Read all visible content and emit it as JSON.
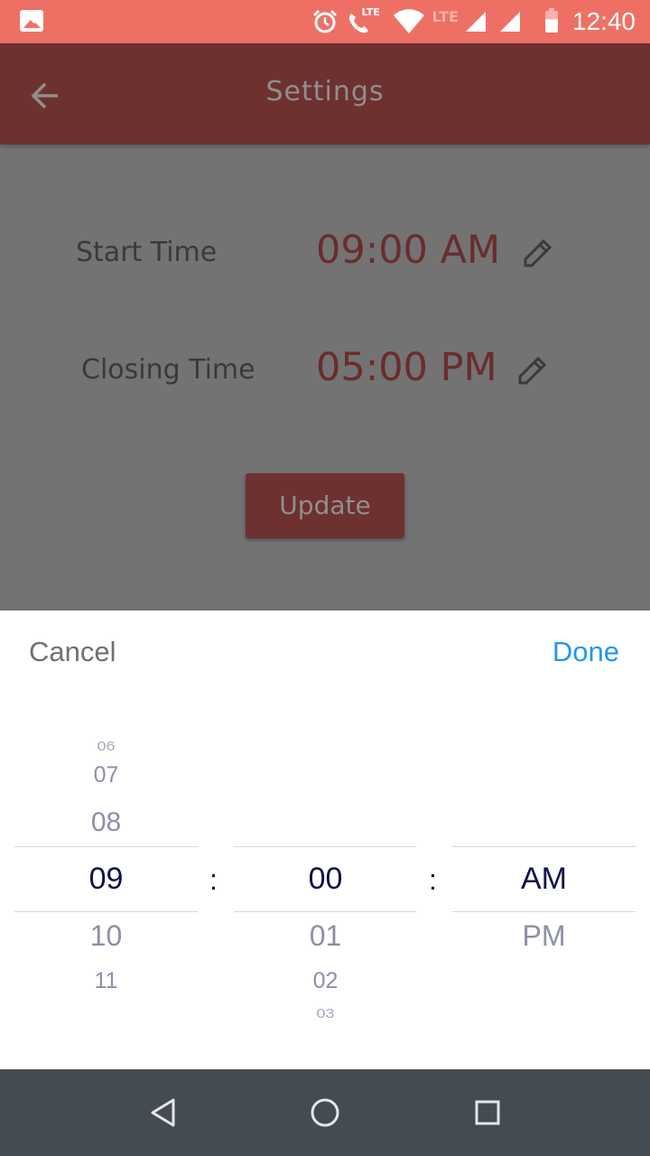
{
  "status_bar": {
    "time": "12:40",
    "lte_label_1": "LTE",
    "lte_label_2": "LTE",
    "icons": [
      "gallery-icon",
      "alarm-icon",
      "call-lte-icon",
      "wifi-icon",
      "signal-icon",
      "signal-icon",
      "battery-icon"
    ]
  },
  "app_bar": {
    "title": "Settings",
    "back_icon": "arrow-back-icon"
  },
  "settings": {
    "start_label": "Start Time",
    "start_value": "09:00 AM",
    "closing_label": "Closing Time",
    "closing_value": "05:00 PM",
    "update_label": "Update",
    "edit_icon": "pencil-icon"
  },
  "picker": {
    "cancel_label": "Cancel",
    "done_label": "Done",
    "separator": ":",
    "hours": {
      "above": [
        "06",
        "07",
        "08"
      ],
      "selected": "09",
      "below": [
        "10",
        "11"
      ]
    },
    "minutes": {
      "selected": "00",
      "below": [
        "01",
        "02",
        "03"
      ]
    },
    "period": {
      "selected": "AM",
      "below": [
        "PM"
      ]
    }
  },
  "colors": {
    "status_bar": "#ee7065",
    "app_bar": "#6d3130",
    "accent_value": "#6b2c2c",
    "done_blue": "#2196f3",
    "selected_text": "#10124a",
    "unselected_text": "#8e8fa8",
    "nav_bar": "#454b52"
  },
  "nav_bar": {
    "icons": [
      "back-triangle-icon",
      "home-circle-icon",
      "recents-square-icon"
    ]
  }
}
